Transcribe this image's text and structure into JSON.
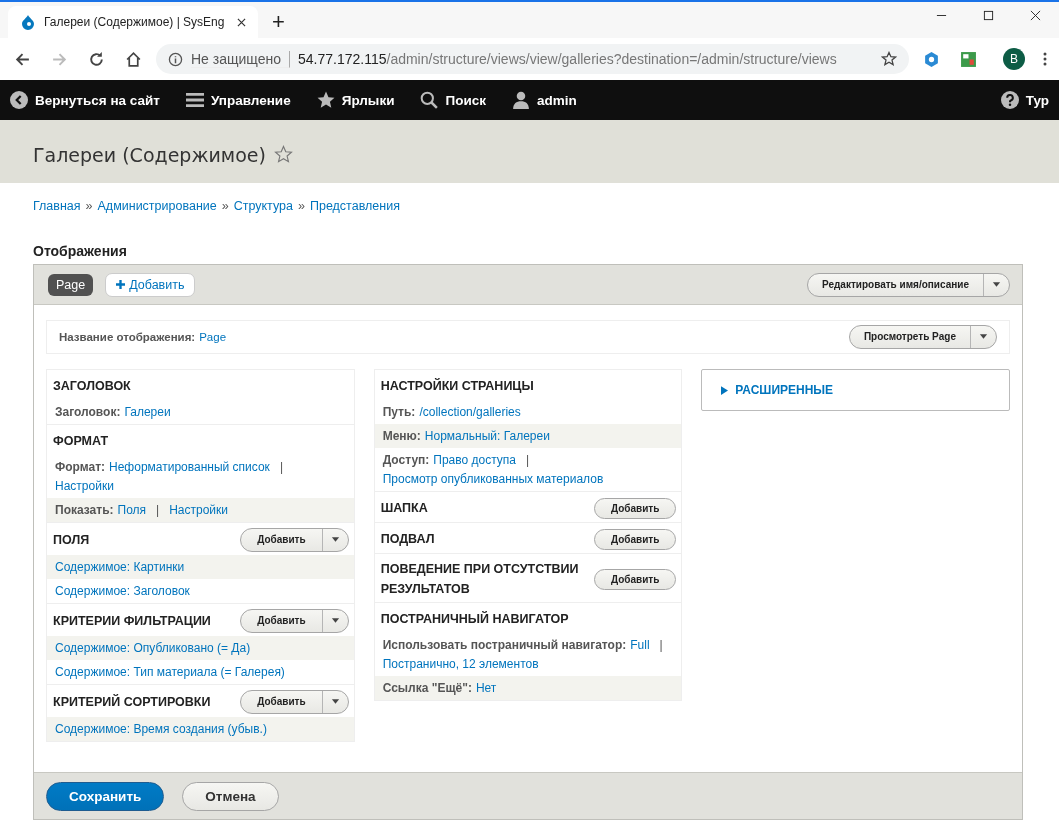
{
  "browser": {
    "tab_title": "Галереи (Содержимое) | SysEng",
    "new_tab": "+",
    "security": "Не защищено",
    "url_host": "54.77.172.115",
    "url_path": "/admin/structure/views/view/galleries?destination=/admin/structure/views",
    "profile": "B"
  },
  "toolbar": {
    "items": [
      {
        "kind": "back",
        "label": "Вернуться на сайт"
      },
      {
        "kind": "menu",
        "label": "Управление"
      },
      {
        "kind": "star",
        "label": "Ярлыки"
      },
      {
        "kind": "search",
        "label": "Поиск"
      },
      {
        "kind": "user",
        "label": "admin"
      }
    ],
    "tour": "Тур"
  },
  "page_title": "Галереи (Содержимое)",
  "breadcrumb": [
    {
      "kind": "link",
      "text": "Главная"
    },
    {
      "kind": "sep",
      "text": "»"
    },
    {
      "kind": "link",
      "text": "Администрирование"
    },
    {
      "kind": "sep",
      "text": "»"
    },
    {
      "kind": "link",
      "text": "Структура"
    },
    {
      "kind": "sep",
      "text": "»"
    },
    {
      "kind": "link",
      "text": "Представления"
    }
  ],
  "displays_heading": "Отображения",
  "display_tabs": [
    {
      "label": "Page",
      "selected": true
    }
  ],
  "add_display": "Добавить",
  "edit_button": "Редактировать имя/описание",
  "display_name": {
    "label": "Название отображения:",
    "value": "Page"
  },
  "preview_button": "Просмотреть Page",
  "columns": [
    {
      "sections": [
        {
          "title": "ЗАГОЛОВОК",
          "rows": [
            {
              "shaded": false,
              "label": "Заголовок:",
              "parts": [
                {
                  "kind": "link",
                  "text": "Галереи"
                }
              ]
            }
          ]
        },
        {
          "title": "ФОРМАТ",
          "rows": [
            {
              "shaded": false,
              "label": "Формат:",
              "parts": [
                {
                  "kind": "link",
                  "text": "Неформатированный список"
                },
                {
                  "kind": "sep",
                  "text": "|"
                },
                {
                  "kind": "link",
                  "text": "Настройки"
                }
              ]
            },
            {
              "shaded": true,
              "label": "Показать:",
              "parts": [
                {
                  "kind": "link",
                  "text": "Поля"
                },
                {
                  "kind": "sep",
                  "text": "|"
                },
                {
                  "kind": "link",
                  "text": "Настройки"
                }
              ]
            }
          ]
        },
        {
          "title": "ПОЛЯ",
          "add": {
            "kind": "split",
            "label": "Добавить"
          },
          "rows": [
            {
              "shaded": true,
              "parts": [
                {
                  "kind": "link",
                  "text": "Содержимое: Картинки"
                }
              ]
            },
            {
              "shaded": false,
              "parts": [
                {
                  "kind": "link",
                  "text": "Содержимое: Заголовок"
                }
              ]
            }
          ]
        },
        {
          "title": "КРИТЕРИИ ФИЛЬТРАЦИИ",
          "add": {
            "kind": "split",
            "label": "Добавить"
          },
          "rows": [
            {
              "shaded": true,
              "parts": [
                {
                  "kind": "link",
                  "text": "Содержимое: Опубликовано (= Да)"
                }
              ]
            },
            {
              "shaded": false,
              "parts": [
                {
                  "kind": "link",
                  "text": "Содержимое: Тип материала (= Галерея)"
                }
              ]
            }
          ]
        },
        {
          "title": "КРИТЕРИЙ СОРТИРОВКИ",
          "add": {
            "kind": "split",
            "label": "Добавить"
          },
          "rows": [
            {
              "shaded": true,
              "parts": [
                {
                  "kind": "link",
                  "text": "Содержимое: Время создания (убыв.)"
                }
              ]
            }
          ]
        }
      ]
    },
    {
      "sections": [
        {
          "title": "НАСТРОЙКИ СТРАНИЦЫ",
          "rows": [
            {
              "shaded": false,
              "label": "Путь:",
              "parts": [
                {
                  "kind": "link",
                  "text": "/collection/galleries"
                }
              ]
            },
            {
              "shaded": true,
              "label": "Меню:",
              "parts": [
                {
                  "kind": "link",
                  "text": "Нормальный: Галереи"
                }
              ]
            },
            {
              "shaded": false,
              "label": "Доступ:",
              "parts": [
                {
                  "kind": "link",
                  "text": "Право доступа"
                },
                {
                  "kind": "sep",
                  "text": "|"
                },
                {
                  "kind": "link",
                  "text": "Просмотр опубликованных материалов"
                }
              ]
            }
          ]
        },
        {
          "title": "ШАПКА",
          "add": {
            "kind": "plain",
            "label": "Добавить"
          }
        },
        {
          "title": "ПОДВАЛ",
          "add": {
            "kind": "plain",
            "label": "Добавить"
          }
        },
        {
          "title": "ПОВЕДЕНИЕ ПРИ ОТСУТСТВИИ РЕЗУЛЬТАТОВ",
          "add": {
            "kind": "plain",
            "label": "Добавить"
          }
        },
        {
          "title": "ПОСТРАНИЧНЫЙ НАВИГАТОР",
          "rows": [
            {
              "shaded": false,
              "label": "Использовать постраничный навигатор:",
              "parts": [
                {
                  "kind": "link",
                  "text": "Full"
                },
                {
                  "kind": "sep",
                  "text": "|"
                },
                {
                  "kind": "link",
                  "text": "Постранично, 12 элементов"
                }
              ]
            },
            {
              "shaded": true,
              "label": "Ссылка \"Ещё\":",
              "parts": [
                {
                  "kind": "link",
                  "text": "Нет"
                }
              ]
            }
          ]
        }
      ]
    }
  ],
  "advanced": {
    "label": "РАСШИРЕННЫЕ",
    "expanded": false
  },
  "actions": [
    {
      "kind": "primary",
      "label": "Сохранить"
    },
    {
      "kind": "secondary",
      "label": "Отмена"
    }
  ]
}
